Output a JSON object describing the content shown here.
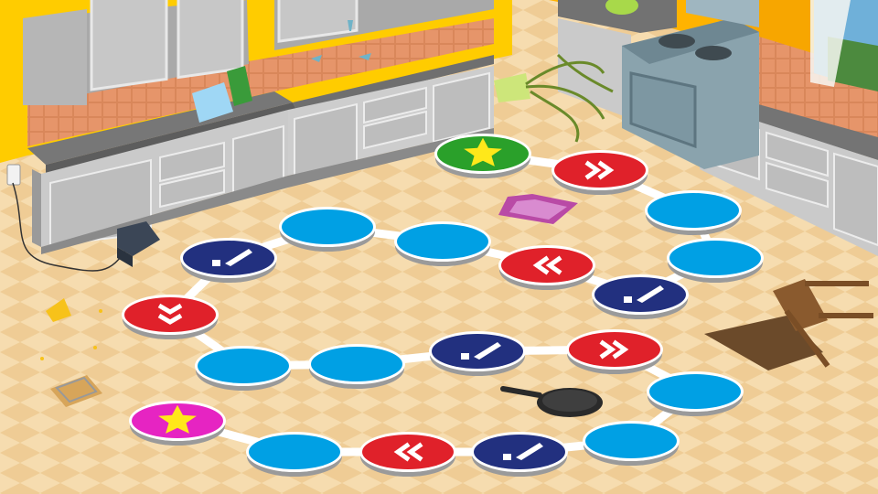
{
  "colors": {
    "wall": "#ffcc00",
    "floor_light": "#f6dcaf",
    "floor_dark": "#ecc68d",
    "counter_top": "#7b7b7b",
    "cabinet": "#c9c9c9",
    "cabinet_panel": "#bdbdbd",
    "backsplash": "#d9875a",
    "path": "#ffffff",
    "blue_space": "#00a0e4",
    "red_space": "#e0212a",
    "navy_space": "#22307f",
    "start_space": "#2aa02a",
    "finish_space": "#e624c2",
    "star": "#ffe81a"
  },
  "board": {
    "spaces": [
      {
        "kind": "start",
        "icon": "star"
      },
      {
        "kind": "action",
        "icon": "forward-arrows"
      },
      {
        "kind": "blank",
        "icon": "none"
      },
      {
        "kind": "blank",
        "icon": "none"
      },
      {
        "kind": "event",
        "icon": "exclamation"
      },
      {
        "kind": "action",
        "icon": "back-arrows"
      },
      {
        "kind": "blank",
        "icon": "none"
      },
      {
        "kind": "blank",
        "icon": "none"
      },
      {
        "kind": "event",
        "icon": "exclamation"
      },
      {
        "kind": "action",
        "icon": "down-arrows"
      },
      {
        "kind": "blank",
        "icon": "none"
      },
      {
        "kind": "blank",
        "icon": "none"
      },
      {
        "kind": "event",
        "icon": "exclamation"
      },
      {
        "kind": "action",
        "icon": "forward-arrows"
      },
      {
        "kind": "blank",
        "icon": "none"
      },
      {
        "kind": "blank",
        "icon": "none"
      },
      {
        "kind": "event",
        "icon": "exclamation"
      },
      {
        "kind": "action",
        "icon": "back-arrows"
      },
      {
        "kind": "blank",
        "icon": "none"
      },
      {
        "kind": "finish",
        "icon": "star"
      }
    ]
  },
  "props": {
    "stove": "stove-icon",
    "toaster": "toaster-icon",
    "blender": "blender-icon",
    "chair": "tipped-chair-icon",
    "frying_pan": "frying-pan-icon",
    "mousetrap": "mousetrap-icon",
    "cheese": "cheese-icon",
    "rug": "rug-icon",
    "plant": "plant-icon",
    "glasses": "wine-glass-icon",
    "outlet": "outlet-icon",
    "window": "window-icon"
  }
}
